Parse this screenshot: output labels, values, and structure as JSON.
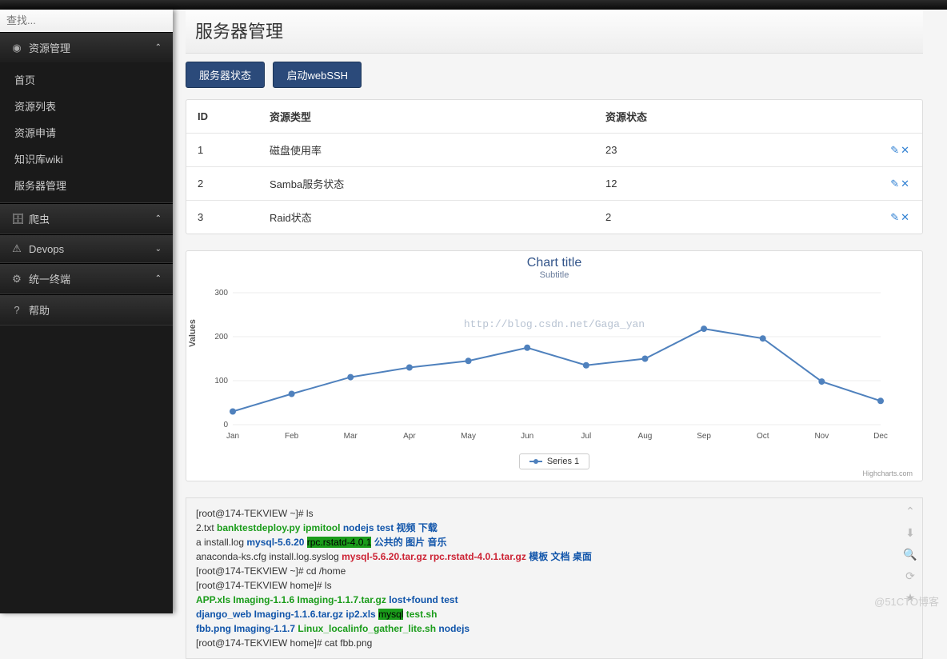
{
  "search": {
    "placeholder": "查找..."
  },
  "sidebar": {
    "groups": [
      {
        "icon": "◉",
        "label": "资源管理",
        "expanded": true,
        "items": [
          "首页",
          "资源列表",
          "资源申请",
          "知识库wiki",
          "服务器管理"
        ]
      },
      {
        "icon": "🗄",
        "label": "爬虫",
        "expanded": true,
        "items": []
      },
      {
        "icon": "⚠",
        "label": "Devops",
        "expanded": false,
        "items": []
      },
      {
        "icon": "⚙",
        "label": "统一终端",
        "expanded": true,
        "items": []
      },
      {
        "icon": "?",
        "label": "帮助",
        "expanded": null,
        "items": []
      }
    ]
  },
  "page_title": "服务器管理",
  "buttons": {
    "status": "服务器状态",
    "ssh": "启动webSSH"
  },
  "table": {
    "headers": [
      "ID",
      "资源类型",
      "资源状态"
    ],
    "rows": [
      {
        "id": "1",
        "type": "磁盘使用率",
        "status": "23"
      },
      {
        "id": "2",
        "type": "Samba服务状态",
        "status": "12"
      },
      {
        "id": "3",
        "type": "Raid状态",
        "status": "2"
      }
    ],
    "action_icons": "✎✕"
  },
  "chart_data": {
    "type": "line",
    "title": "Chart title",
    "subtitle": "Subtitle",
    "ylabel": "Values",
    "watermark": "http://blog.csdn.net/Gaga_yan",
    "categories": [
      "Jan",
      "Feb",
      "Mar",
      "Apr",
      "May",
      "Jun",
      "Jul",
      "Aug",
      "Sep",
      "Oct",
      "Nov",
      "Dec"
    ],
    "series": [
      {
        "name": "Series 1",
        "values": [
          30,
          70,
          108,
          130,
          145,
          175,
          135,
          150,
          218,
          196,
          98,
          54
        ]
      }
    ],
    "ylim": [
      0,
      300
    ],
    "yticks": [
      0,
      100,
      200,
      300
    ],
    "credits": "Highcharts.com"
  },
  "terminal": {
    "lines": [
      [
        {
          "t": "[root@174-TEKVIEW ~]# ls"
        }
      ],
      [
        {
          "t": "2.txt           "
        },
        {
          "t": "banktestdeploy.py   ipmitool",
          "c": "g"
        },
        {
          "t": "            "
        },
        {
          "t": "nodejs",
          "c": "b"
        },
        {
          "t": "                 "
        },
        {
          "t": "test",
          "c": "b"
        },
        {
          "t": "   视频  下载",
          "c": "b"
        }
      ],
      [
        {
          "t": "a               install.log         "
        },
        {
          "t": "mysql-5.6.20",
          "c": "b"
        },
        {
          "t": "        "
        },
        {
          "t": "rpc.rstatd-4.0.1",
          "c": "hl"
        },
        {
          "t": "       公共的 图片  音乐",
          "c": "b"
        }
      ],
      [
        {
          "t": "anaconda-ks.cfg install.log.syslog  "
        },
        {
          "t": "mysql-5.6.20.tar.gz",
          "c": "r"
        },
        {
          "t": "  "
        },
        {
          "t": "rpc.rstatd-4.0.1.tar.gz",
          "c": "r"
        },
        {
          "t": " 模板   文档  桌面",
          "c": "b"
        }
      ],
      [
        {
          "t": "[root@174-TEKVIEW ~]# cd /home"
        }
      ],
      [
        {
          "t": "[root@174-TEKVIEW home]# ls"
        }
      ],
      [
        {
          "t": "APP.xls    Imaging-1.1.6         Imaging-1.1.7.tar.gz",
          "c": "g"
        },
        {
          "t": "            "
        },
        {
          "t": "lost+found",
          "c": "b"
        },
        {
          "t": "  "
        },
        {
          "t": "test",
          "c": "b"
        }
      ],
      [
        {
          "t": "django_web Imaging-1.1.6.tar.gz  ip2.xls",
          "c": "b"
        },
        {
          "t": "                         "
        },
        {
          "t": "mysql",
          "c": "hl"
        },
        {
          "t": "       test.sh",
          "c": "g"
        }
      ],
      [
        {
          "t": "fbb.png    Imaging-1.1.7",
          "c": "b"
        },
        {
          "t": "         "
        },
        {
          "t": "Linux_localinfo_gather_lite.sh",
          "c": "g"
        },
        {
          "t": "  "
        },
        {
          "t": "nodejs",
          "c": "b"
        }
      ],
      [
        {
          "t": "[root@174-TEKVIEW home]# cat fbb.png"
        }
      ]
    ]
  },
  "footer_watermark": "@51CTO博客"
}
